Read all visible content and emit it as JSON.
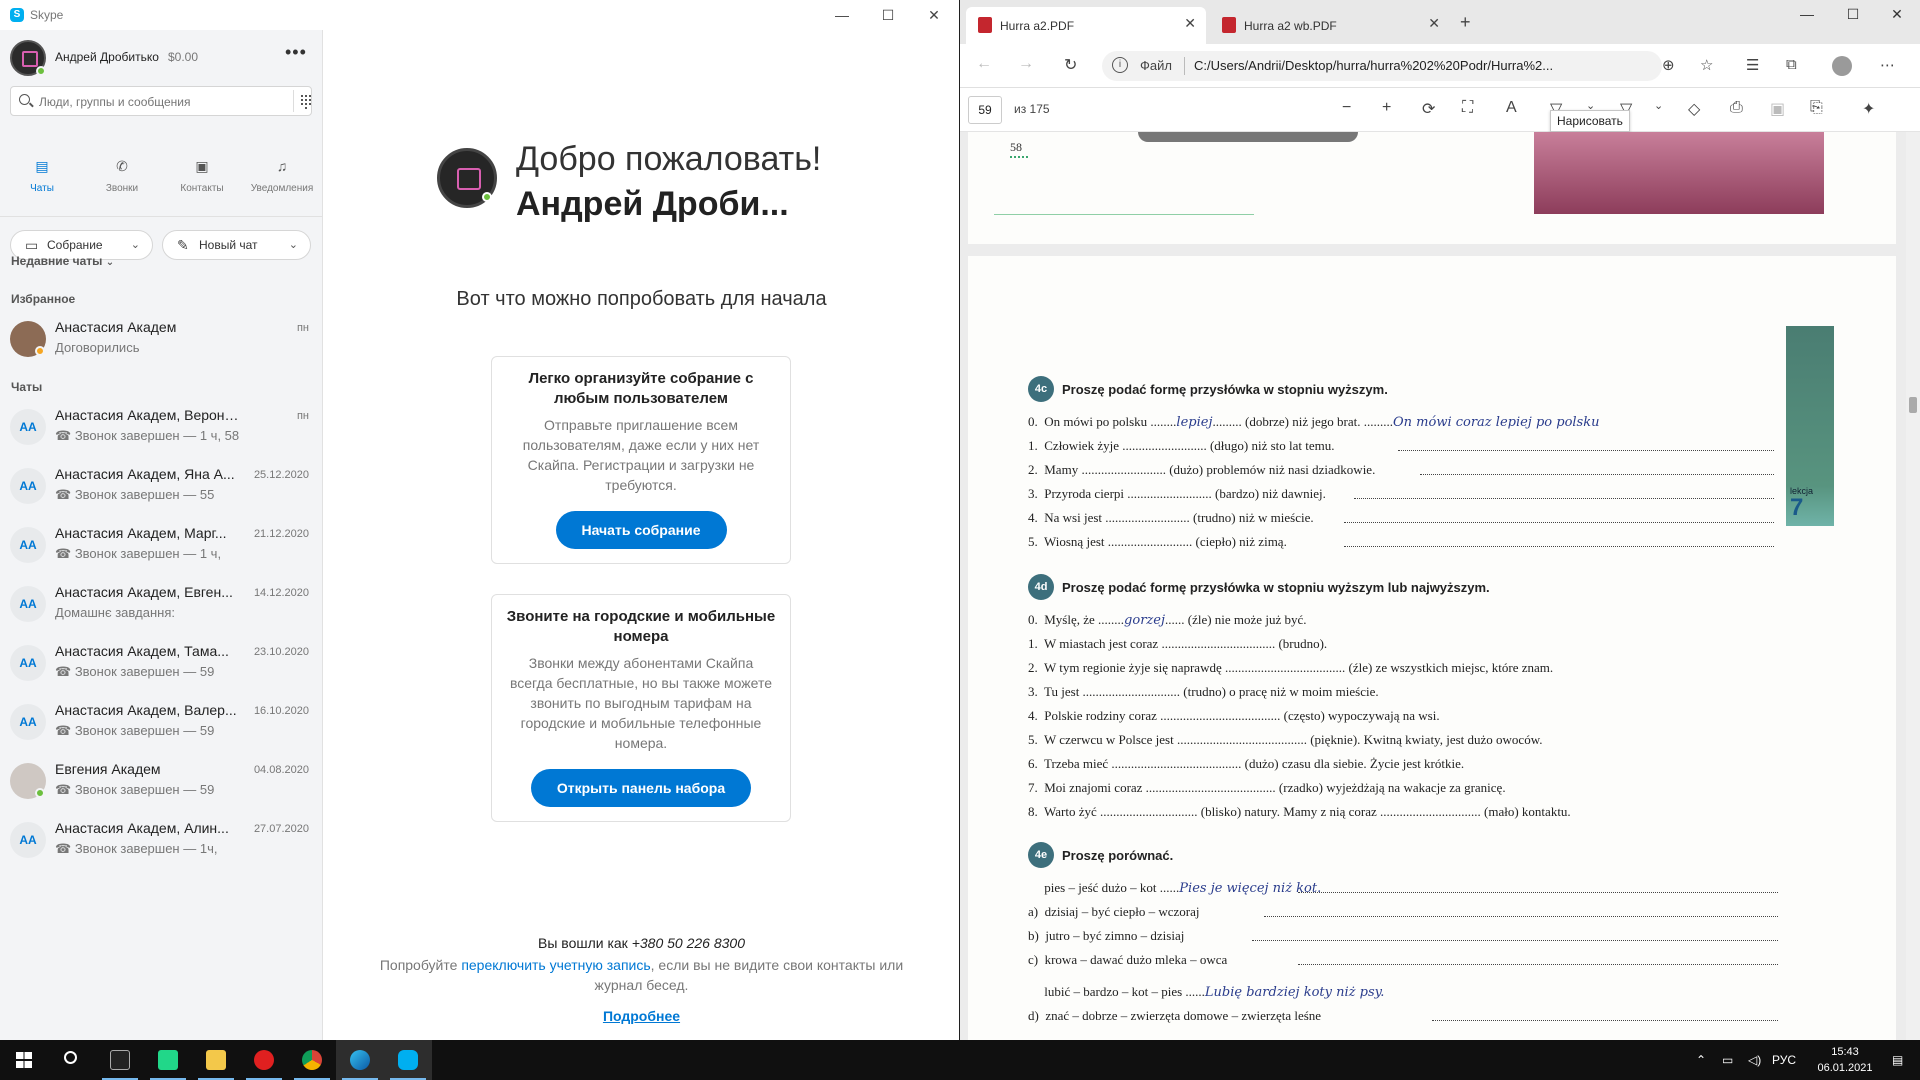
{
  "skype": {
    "window_title": "Skype",
    "profile": {
      "name": "Андрей Дробитько",
      "balance": "$0.00"
    },
    "search_placeholder": "Люди, группы и сообщения",
    "nav": [
      {
        "label": "Чаты",
        "icon": "chat-icon"
      },
      {
        "label": "Звонки",
        "icon": "phone-icon"
      },
      {
        "label": "Контакты",
        "icon": "contacts-icon"
      },
      {
        "label": "Уведомления",
        "icon": "bell-icon"
      }
    ],
    "meeting_button": "Собрание",
    "new_chat_button": "Новый чат",
    "recent_chats_label": "Недавние чаты",
    "favorites_label": "Избранное",
    "favorites": [
      {
        "initials": "",
        "name": "Анастасия Академ",
        "message": "Договорились",
        "date": "пн"
      }
    ],
    "chats_label": "Чаты",
    "chats": [
      {
        "initials": "AA",
        "name": "Анастасия Академ, Вероника А...",
        "message": "Звонок завершен — 1 ч, 58",
        "date": "пн"
      },
      {
        "initials": "AA",
        "name": "Анастасия Академ, Яна А...",
        "message": "Звонок завершен — 55",
        "date": "25.12.2020"
      },
      {
        "initials": "AA",
        "name": "Анастасия Академ, Марг...",
        "message": "Звонок завершен — 1 ч,",
        "date": "21.12.2020"
      },
      {
        "initials": "AA",
        "name": "Анастасия Академ, Евген...",
        "message": "Домашнє завдання:",
        "date": "14.12.2020"
      },
      {
        "initials": "AA",
        "name": "Анастасия Академ, Тама...",
        "message": "Звонок завершен — 59",
        "date": "23.10.2020"
      },
      {
        "initials": "AA",
        "name": "Анастасия Академ, Валер...",
        "message": "Звонок завершен — 59",
        "date": "16.10.2020"
      },
      {
        "initials": "",
        "name": "Евгения Академ",
        "message": "Звонок завершен — 59",
        "date": "04.08.2020"
      },
      {
        "initials": "AA",
        "name": "Анастасия Академ, Алин...",
        "message": "Звонок завершен — 1ч,",
        "date": "27.07.2020"
      }
    ],
    "welcome": {
      "title": "Добро пожаловать!",
      "name": "Андрей Дроби...",
      "try_text": "Вот что можно попробовать для начала",
      "card1_title": "Легко организуйте собрание с любым пользователем",
      "card1_desc": "Отправьте приглашение всем пользователям, даже если у них нет Скайпа. Регистрации и загрузки не требуются.",
      "card1_button": "Начать собрание",
      "card2_title": "Звоните на городские и мобильные номера",
      "card2_desc": "Звонки между абонентами Скайпа всегда бесплатные, но вы также можете звонить по выгодным тарифам на городские и мобильные телефонные номера.",
      "card2_button": "Открыть панель набора",
      "signed_in_prefix": "Вы вошли как",
      "signed_in_phone": "+380 50 226 8300",
      "switch_prefix": "Попробуйте",
      "switch_link": "переключить учетную запись",
      "switch_suffix": ", если вы не видите свои контакты или журнал бесед.",
      "more_link": "Подробнее"
    }
  },
  "edge": {
    "tabs": [
      {
        "label": "Hurra a2.PDF",
        "active": true
      },
      {
        "label": "Hurra a2 wb.PDF",
        "active": false
      }
    ],
    "address_label": "Файл",
    "url": "C:/Users/Andrii/Desktop/hurra/hurra%202%20Podr/Hurra%2...",
    "page_number": "59",
    "page_count": "из 175",
    "tooltip": "Нарисовать",
    "pdf": {
      "prev_page_number": "58",
      "lekcja_label": "lekcja",
      "lekcja_number": "7",
      "ex_4c": {
        "badge": "4c",
        "heading": "Proszę podać formę przysłówka w stopniu wyższym.",
        "lines": [
          {
            "a": "0.  On mówi po polsku ........",
            "hw": "lepiej",
            "b": "......... (dobrze) niż jego brat. .........",
            "hw2": "On mówi coraz lepiej po polsku",
            "c": ""
          },
          {
            "a": "1.  Człowiek żyje .......................... (długo) niż sto lat temu.",
            "hw": "",
            "b": "",
            "hw2": "",
            "c": ""
          },
          {
            "a": "2.  Mamy .......................... (dużo) problemów niż nasi dziadkowie.",
            "hw": "",
            "b": "",
            "hw2": "",
            "c": ""
          },
          {
            "a": "3.  Przyroda cierpi .......................... (bardzo) niż dawniej.",
            "hw": "",
            "b": "",
            "hw2": "",
            "c": ""
          },
          {
            "a": "4.  Na wsi jest .......................... (trudno) niż w mieście.",
            "hw": "",
            "b": "",
            "hw2": "",
            "c": ""
          },
          {
            "a": "5.  Wiosną jest .......................... (ciepło) niż zimą.",
            "hw": "",
            "b": "",
            "hw2": "",
            "c": ""
          }
        ]
      },
      "ex_4d": {
        "badge": "4d",
        "heading": "Proszę podać formę przysłówka w stopniu wyższym lub najwyższym.",
        "lines": [
          {
            "a": "0.  Myślę, że ........",
            "hw": "gorzej",
            "b": "...... (źle) nie może już być."
          },
          {
            "a": "1.  W miastach jest coraz ................................... (brudno).",
            "hw": "",
            "b": ""
          },
          {
            "a": "2.  W tym regionie żyje się naprawdę ..................................... (źle) ze wszystkich miejsc, które znam.",
            "hw": "",
            "b": ""
          },
          {
            "a": "3.  Tu jest .............................. (trudno) o pracę niż w moim mieście.",
            "hw": "",
            "b": ""
          },
          {
            "a": "4.  Polskie rodziny coraz ..................................... (często) wypoczywają na wsi.",
            "hw": "",
            "b": ""
          },
          {
            "a": "5.  W czerwcu w Polsce jest ........................................ (pięknie). Kwitną kwiaty, jest dużo owoców.",
            "hw": "",
            "b": ""
          },
          {
            "a": "6.  Trzeba mieć ........................................ (dużo) czasu dla siebie. Życie jest krótkie.",
            "hw": "",
            "b": ""
          },
          {
            "a": "7.  Moi znajomi coraz ........................................ (rzadko) wyjeżdżają na wakacje za granicę.",
            "hw": "",
            "b": ""
          },
          {
            "a": "8.  Warto żyć .............................. (blisko) natury. Mamy z nią coraz ............................... (mało) kontaktu.",
            "hw": "",
            "b": ""
          }
        ]
      },
      "ex_4e": {
        "badge": "4e",
        "heading": "Proszę porównać.",
        "lines": [
          {
            "a": "     pies – jeść dużo – kot ......",
            "hw": "Pies je więcej niż kot."
          },
          {
            "a": "a)  dzisiaj – być ciepło – wczoraj",
            "hw": ""
          },
          {
            "a": "b)  jutro – być zimno – dzisiaj",
            "hw": ""
          },
          {
            "a": "c)  krowa – dawać dużo mleka – owca",
            "hw": ""
          },
          {
            "a": "     lubić – bardzo – kot – pies ......",
            "hw": "Lubię bardziej koty niż psy."
          },
          {
            "a": "d)  znać – dobrze – zwierzęta domowe – zwierzęta leśne",
            "hw": ""
          }
        ]
      }
    }
  },
  "taskbar": {
    "language": "РУС",
    "time": "15:43",
    "date": "06.01.2021"
  }
}
